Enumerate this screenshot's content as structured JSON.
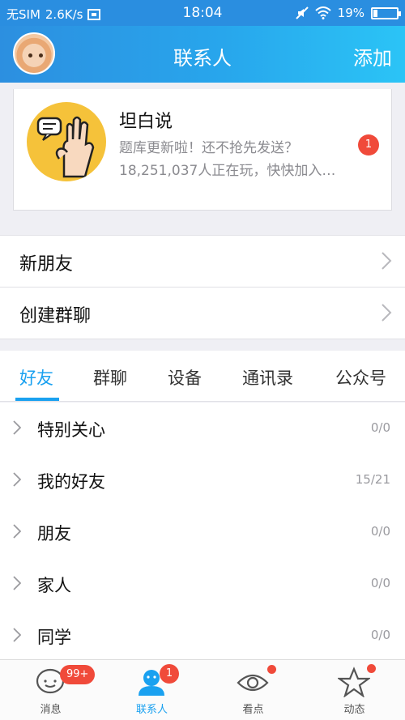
{
  "status_bar": {
    "carrier": "无SIM",
    "speed": "2.6K/s",
    "time": "18:04",
    "battery": "19%",
    "battery_level": 0.19
  },
  "header": {
    "title": "联系人",
    "add_label": "添加"
  },
  "promo": {
    "title": "坦白说",
    "subtitle": "题库更新啦！还不抢先发送？",
    "players": "18,251,037人正在玩，快快加入…",
    "badge": "1"
  },
  "rows": {
    "new_friends": "新朋友",
    "create_group": "创建群聊"
  },
  "tabs": [
    "好友",
    "群聊",
    "设备",
    "通讯录",
    "公众号"
  ],
  "active_tab": "好友",
  "groups": [
    {
      "name": "特别关心",
      "count": "0/0"
    },
    {
      "name": "我的好友",
      "count": "15/21"
    },
    {
      "name": "朋友",
      "count": "0/0"
    },
    {
      "name": "家人",
      "count": "0/0"
    },
    {
      "name": "同学",
      "count": "0/0"
    }
  ],
  "bottom_nav": [
    {
      "label": "消息",
      "icon": "message-icon",
      "badge": "99+"
    },
    {
      "label": "联系人",
      "icon": "contacts-icon",
      "badge": "1"
    },
    {
      "label": "看点",
      "icon": "eye-icon"
    },
    {
      "label": "动态",
      "icon": "star-icon"
    }
  ],
  "colors": {
    "accent": "#1aa1f0",
    "badge": "#f04a3a",
    "header_start": "#2c8fe0",
    "header_end": "#2bc4f6"
  }
}
